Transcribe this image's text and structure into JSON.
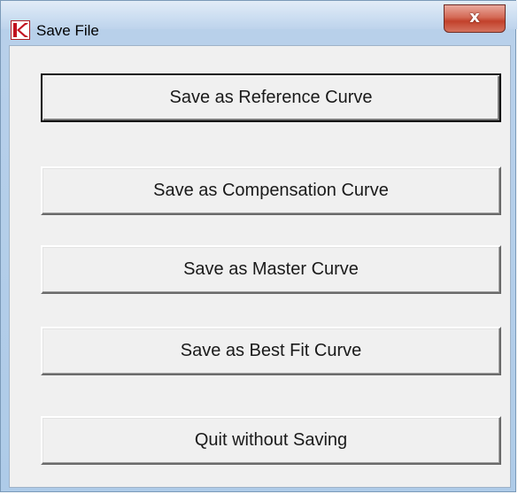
{
  "window": {
    "title": "Save File",
    "icon": "app-logo-icon",
    "close_label": "x"
  },
  "buttons": {
    "reference": "Save as Reference Curve",
    "compensation": "Save as Compensation Curve",
    "master": "Save as Master Curve",
    "best_fit": "Save as Best Fit Curve",
    "quit": "Quit without Saving"
  },
  "colors": {
    "titlebar": "#c9dcf0",
    "close_button": "#c8452f",
    "logo_red": "#c1121f",
    "face": "#f0f0f0"
  }
}
